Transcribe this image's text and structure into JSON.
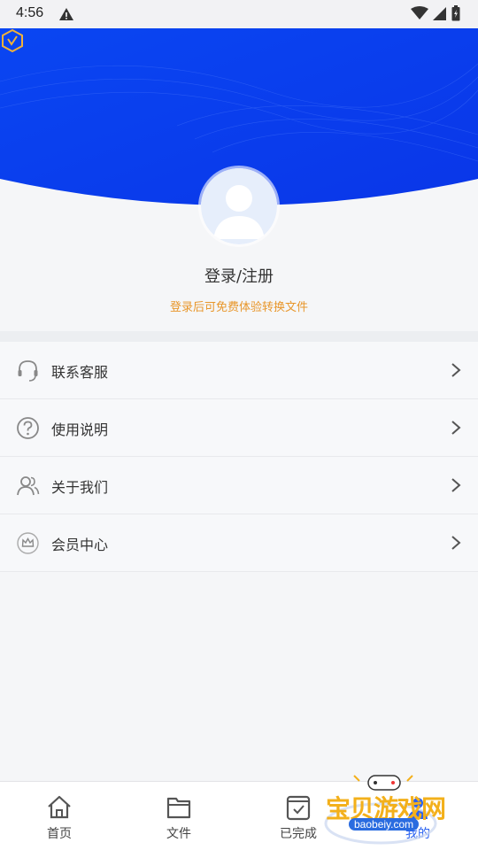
{
  "status_bar": {
    "time": "4:56"
  },
  "profile": {
    "login_title": "登录/注册",
    "login_subtitle": "登录后可免费体验转换文件"
  },
  "menu": {
    "items": [
      {
        "label": "联系客服",
        "icon": "headset-icon"
      },
      {
        "label": "使用说明",
        "icon": "question-icon"
      },
      {
        "label": "关于我们",
        "icon": "users-icon"
      },
      {
        "label": "会员中心",
        "icon": "crown-icon"
      }
    ]
  },
  "tabbar": {
    "tabs": [
      {
        "label": "首页",
        "icon": "home-icon"
      },
      {
        "label": "文件",
        "icon": "folder-icon"
      },
      {
        "label": "已完成",
        "icon": "check-doc-icon"
      },
      {
        "label": "我的",
        "icon": "user-icon"
      }
    ]
  },
  "watermark": {
    "text": "宝贝游戏网",
    "url": "baobeiy.com"
  },
  "colors": {
    "header_blue": "#0a3ff0",
    "accent_orange": "#e8962a",
    "background": "#f5f6f8"
  }
}
